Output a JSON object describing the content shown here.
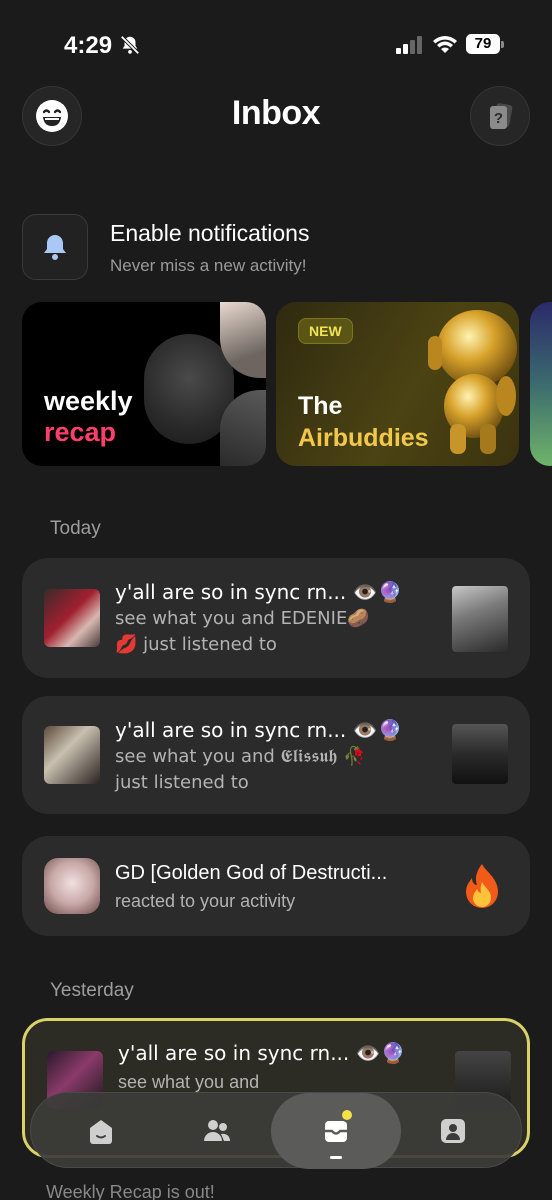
{
  "status_bar": {
    "time": "4:29",
    "battery": "79"
  },
  "header": {
    "title": "Inbox"
  },
  "notifications_prompt": {
    "title": "Enable notifications",
    "subtitle": "Never miss a new activity!"
  },
  "promos": {
    "recap": {
      "line1": "weekly",
      "line2": "recap"
    },
    "airbuddies": {
      "badge": "NEW",
      "line1": "The",
      "line2": "Airbuddies"
    }
  },
  "sections": {
    "today": "Today",
    "yesterday": "Yesterday"
  },
  "activities": [
    {
      "title": "y'all are so in sync rn... 👁️🔮",
      "line1": "see what you and EDENIE🥔",
      "line2": "💋 just listened to"
    },
    {
      "title": "y'all are so in sync rn... 👁️🔮",
      "line1": "see what you and 𝕰𝖑𝖎𝖘𝖘𝖚𝖍 🥀",
      "line2": "just listened to"
    },
    {
      "title": "GD [Golden God of Destructi...",
      "line1": "reacted to your activity",
      "reaction": "🔥"
    },
    {
      "title": "y'all are so in sync rn... 👁️🔮",
      "line1": "see what you and"
    }
  ],
  "peek": {
    "text": "Weekly Recap is out!"
  },
  "nav": {
    "items": [
      "home",
      "friends",
      "inbox",
      "profile"
    ],
    "active": "inbox"
  },
  "colors": {
    "background": "#1b1b1b",
    "card": "#2b2b2b",
    "recap_accent": "#ff3f6a",
    "air_accent": "#f2c84b",
    "highlight_border": "#d8d268"
  }
}
